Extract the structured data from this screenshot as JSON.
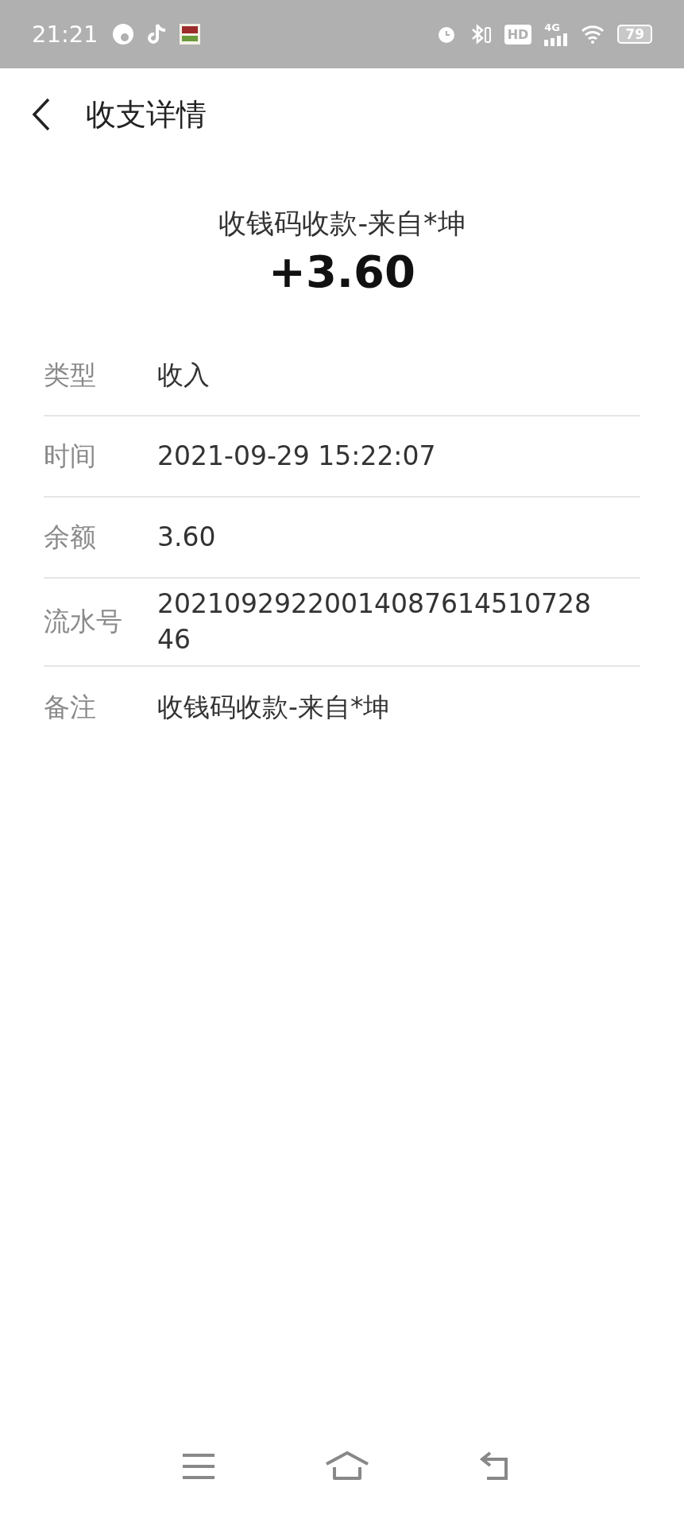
{
  "status_bar": {
    "time": "21:21",
    "network": "4G",
    "hd": "HD",
    "battery": "79"
  },
  "header": {
    "title": "收支详情"
  },
  "summary": {
    "title": "收钱码收款-来自*坤",
    "amount": "+3.60"
  },
  "details": [
    {
      "label": "类型",
      "value": "收入"
    },
    {
      "label": "时间",
      "value": "2021-09-29 15:22:07"
    },
    {
      "label": "余额",
      "value": "3.60"
    },
    {
      "label": "流水号",
      "value": "2021092922001408761451072846"
    },
    {
      "label": "备注",
      "value": "收钱码收款-来自*坤"
    }
  ]
}
